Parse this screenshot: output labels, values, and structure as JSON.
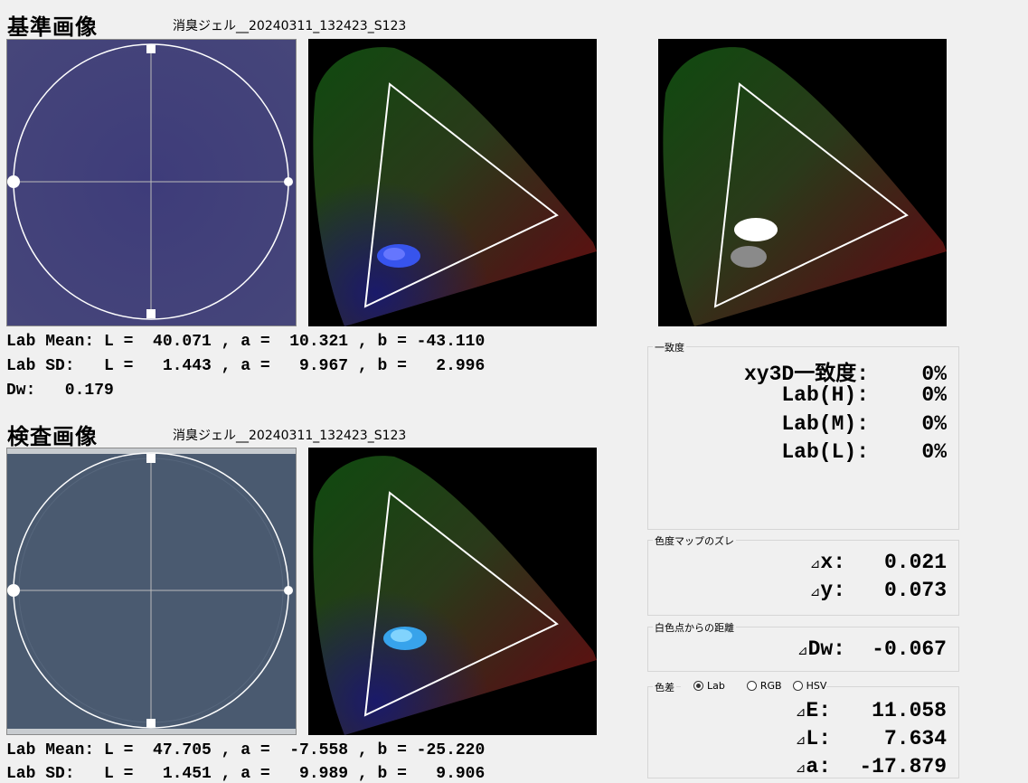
{
  "reference": {
    "title": "基準画像",
    "filename": "消臭ジェル__20240311_132423_S123",
    "sample_color": "#3f3d78",
    "lab_mean_line": "Lab Mean: L =  40.071 , a =  10.321 , b = -43.110",
    "lab_sd_line": "Lab SD:   L =   1.443 , a =   9.967 , b =   2.996",
    "dw_line": "Dw:   0.179"
  },
  "inspection": {
    "title": "検査画像",
    "filename": "消臭ジェル__20240311_132423_S123",
    "sample_color": "#495a70",
    "lab_mean_line": "Lab Mean: L =  47.705 , a =  -7.558 , b = -25.220",
    "lab_sd_line": "Lab SD:   L =   1.451 , a =   9.989 , b =   9.906"
  },
  "match": {
    "group_label": "一致度",
    "rows": [
      {
        "label": "xy3D一致度:",
        "value": "0%"
      },
      {
        "label": "Lab(H):",
        "value": "0%"
      },
      {
        "label": "Lab(M):",
        "value": "0%"
      },
      {
        "label": "Lab(L):",
        "value": "0%"
      }
    ]
  },
  "map_shift": {
    "group_label": "色度マップのズレ",
    "dx_symbol": "⊿",
    "dx_label": "x:",
    "dx_value": "0.021",
    "dy_symbol": "⊿",
    "dy_label": "y:",
    "dy_value": "0.073"
  },
  "white_point": {
    "group_label": "白色点からの距離",
    "symbol": "⊿",
    "label": "Dw:",
    "value": "-0.067"
  },
  "color_diff": {
    "group_label": "色差",
    "modes": [
      {
        "label": "Lab",
        "selected": true
      },
      {
        "label": "RGB",
        "selected": false
      },
      {
        "label": "HSV",
        "selected": false
      }
    ],
    "rows": [
      {
        "symbol": "⊿",
        "label": "E:",
        "value": "11.058"
      },
      {
        "symbol": "⊿",
        "label": "L:",
        "value": "7.634"
      },
      {
        "symbol": "⊿",
        "label": "a:",
        "value": "-17.879"
      }
    ]
  }
}
